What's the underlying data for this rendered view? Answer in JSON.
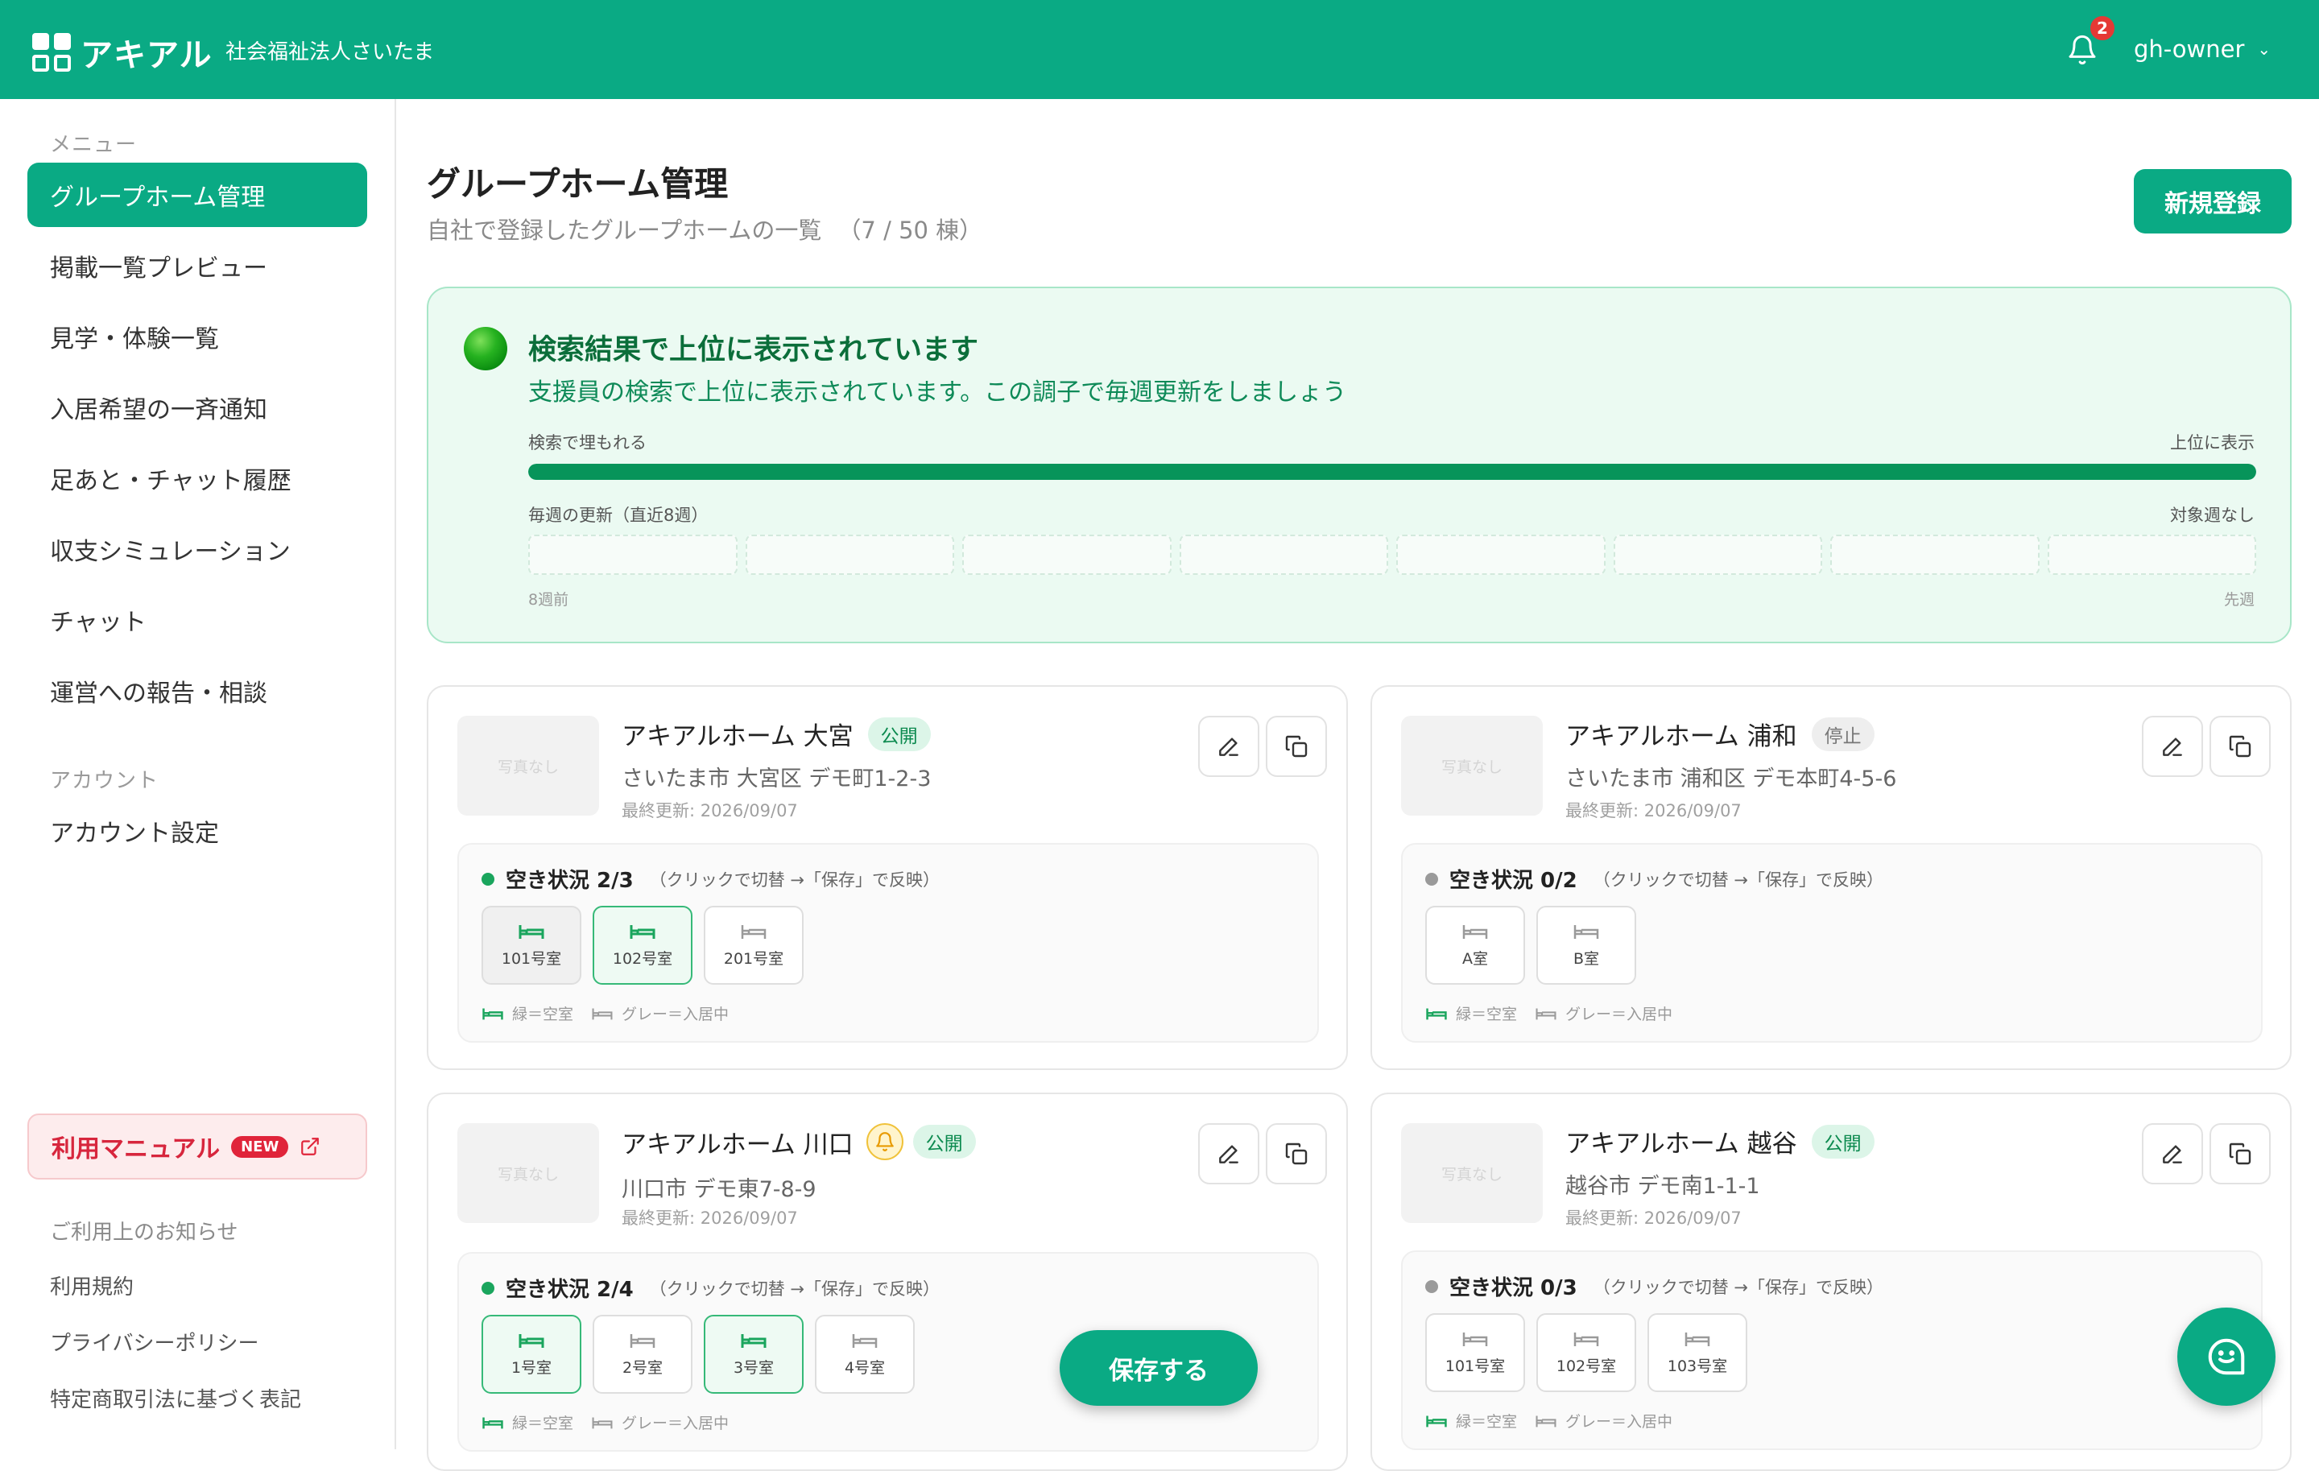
{
  "header": {
    "logo_text": "アキアル",
    "org_name": "社会福祉法人さいたま",
    "notification_count": "2",
    "user_name": "gh-owner"
  },
  "sidebar": {
    "menu_heading": "メニュー",
    "items": [
      {
        "label": "グループホーム管理"
      },
      {
        "label": "掲載一覧プレビュー"
      },
      {
        "label": "見学・体験一覧"
      },
      {
        "label": "入居希望の一斉通知"
      },
      {
        "label": "足あと・チャット履歴"
      },
      {
        "label": "収支シミュレーション"
      },
      {
        "label": "チャット"
      },
      {
        "label": "運営への報告・相談"
      }
    ],
    "account_heading": "アカウント",
    "account_item": "アカウント設定",
    "manual_label": "利用マニュアル",
    "manual_badge": "NEW",
    "notice_heading": "ご利用上のお知らせ",
    "footer_links": [
      "利用規約",
      "プライバシーポリシー",
      "特定商取引法に基づく表記"
    ]
  },
  "page": {
    "title": "グループホーム管理",
    "subtitle": "自社で登録したグループホームの一覧",
    "count": "（7 / 50 棟）",
    "new_button": "新規登録"
  },
  "status": {
    "title": "検索結果で上位に表示されています",
    "description": "支援員の検索で上位に表示されています。この調子で毎週更新をしましょう",
    "bar_left": "検索で埋もれる",
    "bar_right": "上位に表示",
    "rank_fraction": 1.0,
    "weeks_label": "毎週の更新（直近8週）",
    "weeks_status": "対象週なし",
    "weeks_ago": "8週前",
    "weeks_now": "先週"
  },
  "common": {
    "photo_placeholder": "写真なし",
    "vacancy_note": "（クリックで切替 →「保存」で反映）",
    "legend_vacant": "緑＝空室",
    "legend_occupied": "グレー＝入居中",
    "save_button": "保存する"
  },
  "homes": [
    {
      "name": "アキアルホーム 大宮",
      "status": "公開",
      "address": "さいたま市 大宮区 デモ町1-2-3",
      "updated": "最終更新: 2026/09/07",
      "vacancy": "空き状況 2/3",
      "rooms": [
        "101号室",
        "102号室",
        "201号室"
      ]
    },
    {
      "name": "アキアルホーム 浦和",
      "status": "停止",
      "address": "さいたま市 浦和区 デモ本町4-5-6",
      "updated": "最終更新: 2026/09/07",
      "vacancy": "空き状況 0/2",
      "rooms": [
        "A室",
        "B室"
      ]
    },
    {
      "name": "アキアルホーム 川口",
      "status": "公開",
      "address": "川口市 デモ東7-8-9",
      "updated": "最終更新: 2026/09/07",
      "vacancy": "空き状況 2/4",
      "rooms": [
        "1号室",
        "2号室",
        "3号室",
        "4号室"
      ]
    },
    {
      "name": "アキアルホーム 越谷",
      "status": "公開",
      "address": "越谷市 デモ南1-1-1",
      "updated": "最終更新: 2026/09/07",
      "vacancy": "空き状況 0/3",
      "rooms": [
        "101号室",
        "102号室",
        "103号室"
      ]
    }
  ],
  "colors": {
    "brand": "#0aaa84",
    "vacant": "#1aa55d",
    "occupied": "#9a9a9a",
    "alert": "#e53935"
  }
}
